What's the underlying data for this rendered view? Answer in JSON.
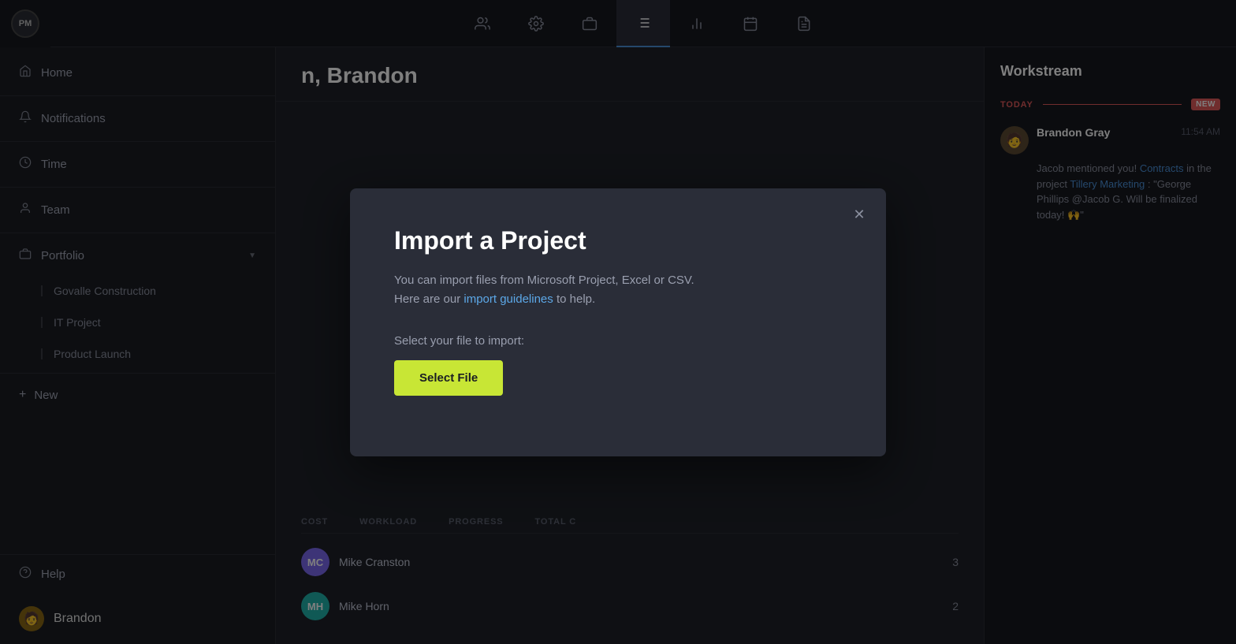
{
  "app": {
    "logo": "PM",
    "title": "n, Brandon"
  },
  "topnav": {
    "items": [
      {
        "id": "people",
        "icon": "👥",
        "active": false
      },
      {
        "id": "settings",
        "icon": "⚙️",
        "active": false
      },
      {
        "id": "briefcase",
        "icon": "💼",
        "active": false
      },
      {
        "id": "list",
        "icon": "☰",
        "active": true
      },
      {
        "id": "chart",
        "icon": "📊",
        "active": false
      },
      {
        "id": "calendar",
        "icon": "📅",
        "active": false
      },
      {
        "id": "document",
        "icon": "📄",
        "active": false
      }
    ]
  },
  "sidebar": {
    "items": [
      {
        "id": "home",
        "label": "Home",
        "icon": "🏠"
      },
      {
        "id": "notifications",
        "label": "Notifications",
        "icon": "🔔"
      },
      {
        "id": "time",
        "label": "Time",
        "icon": "🕐"
      },
      {
        "id": "team",
        "label": "Team",
        "icon": "👤"
      },
      {
        "id": "portfolio",
        "label": "Portfolio",
        "icon": "📁",
        "hasArrow": true
      }
    ],
    "portfolio_items": [
      "Govalle Construction",
      "IT Project",
      "Product Launch"
    ],
    "new_label": "New",
    "help_label": "Help",
    "user_label": "Brandon"
  },
  "page": {
    "title": "n, Brandon"
  },
  "table": {
    "headers": [
      "COST",
      "WORKLOAD",
      "PROGRESS",
      "TOTAL C"
    ],
    "team_rows": [
      {
        "initials": "MC",
        "name": "Mike Cranston",
        "count": 3
      },
      {
        "initials": "MH",
        "name": "Mike Horn",
        "count": 2
      }
    ]
  },
  "workstream": {
    "title": "Workstream",
    "today_label": "TODAY",
    "new_badge": "NEW",
    "items": [
      {
        "name": "Brandon Gray",
        "time": "11:54 AM",
        "avatar_emoji": "🧑",
        "message_plain": "Jacob mentioned you!",
        "link1_text": "Contracts",
        "message_mid": " in the project ",
        "link2_text": "Tillery Marketing",
        "message_end": ": \"George Phillips @Jacob G. Will be finalized today! 🙌\""
      }
    ]
  },
  "modal": {
    "title": "Import a Project",
    "description_start": "You can import files from Microsoft Project, Excel or CSV.\nHere are our ",
    "link_text": "import guidelines",
    "description_end": " to help.",
    "file_label": "Select your file to import:",
    "select_button": "Select File",
    "close_icon": "✕"
  }
}
